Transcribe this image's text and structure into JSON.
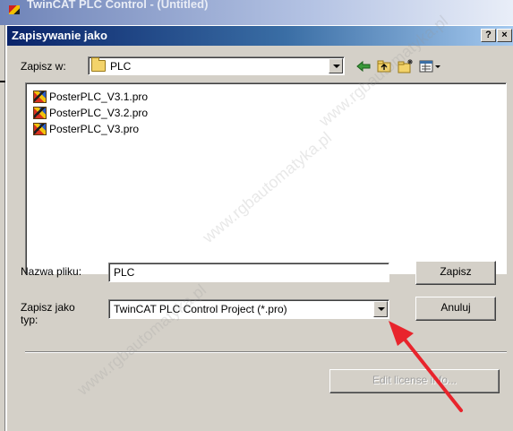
{
  "background_window": {
    "title": "TwinCAT PLC Control - (Untitled)"
  },
  "dialog": {
    "title": "Zapisywanie jako",
    "help_button": "?",
    "close_button": "×",
    "save_in_label": "Zapisz w:",
    "save_in_value": "PLC",
    "toolbar_icons": [
      "back-arrow-icon",
      "up-folder-icon",
      "new-folder-icon",
      "view-menu-icon"
    ],
    "files": [
      {
        "name": "PosterPLC_V3.1.pro",
        "icon": "twincat-project-icon"
      },
      {
        "name": "PosterPLC_V3.2.pro",
        "icon": "twincat-project-icon"
      },
      {
        "name": "PosterPLC_V3.pro",
        "icon": "twincat-project-icon"
      }
    ],
    "filename_label": "Nazwa pliku:",
    "filename_value": "PLC",
    "filetype_label_line1": "Zapisz jako",
    "filetype_label_line2": "typ:",
    "filetype_value": "TwinCAT PLC Control Project (*.pro)",
    "save_button": "Zapisz",
    "cancel_button": "Anuluj",
    "edit_license_button": "Edit license info...",
    "arrow_color": "#e8242c",
    "watermark_text": "www.rgbautomatyka.pl"
  }
}
